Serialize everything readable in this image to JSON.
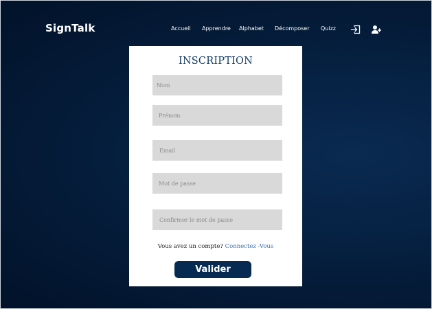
{
  "brand": {
    "name": "SignTalk"
  },
  "nav": {
    "items": [
      "Accueil",
      "Apprendre",
      "Alphabet",
      "Décomposer",
      "Quizz"
    ],
    "icons": [
      "login-icon",
      "add-user-icon"
    ]
  },
  "form": {
    "title": "INSCRIPTION",
    "fields": {
      "nom": {
        "placeholder": "Nom"
      },
      "prenom": {
        "placeholder": "Prénom"
      },
      "email": {
        "placeholder": "Email"
      },
      "password": {
        "placeholder": "Mot de passe"
      },
      "confirm": {
        "placeholder": "Confirmer le mot de passe"
      }
    },
    "account_prompt": "Vous avez un  compte?",
    "login_link": "Connectez -Vous",
    "submit_label": "Valider"
  },
  "colors": {
    "background": "#041a36",
    "card": "#ffffff",
    "title": "#143c66",
    "field": "#d9d9d9",
    "link": "#3a6fb0",
    "button": "#062a52"
  }
}
